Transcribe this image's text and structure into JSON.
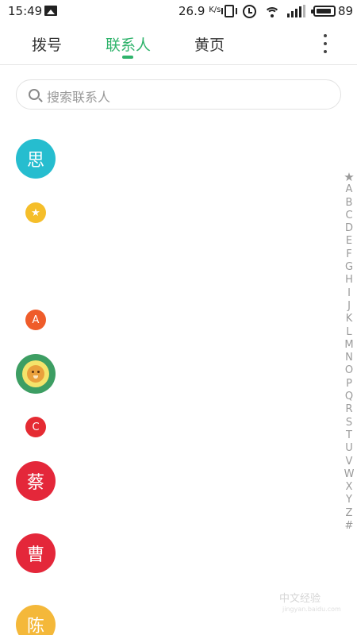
{
  "status_bar": {
    "time": "15:49",
    "network_speed": "26.9",
    "network_speed_unit": "K/s",
    "battery_level": "89",
    "icons": [
      "image-notification-icon",
      "vibrate-icon",
      "alarm-icon",
      "wifi-icon",
      "signal-icon",
      "battery-icon"
    ]
  },
  "tabs": [
    {
      "label": "拨号",
      "active": false
    },
    {
      "label": "联系人",
      "active": true
    },
    {
      "label": "黄页",
      "active": false
    }
  ],
  "accent_color": "#2fb36b",
  "search": {
    "placeholder": "搜索联系人"
  },
  "contacts": {
    "si_initial": "思",
    "star_symbol": "★",
    "section_a": "A",
    "section_c": "C",
    "cai_initial": "蔡",
    "cao_initial": "曹",
    "chen_initial": "陈"
  },
  "index": [
    "★",
    "A",
    "B",
    "C",
    "D",
    "E",
    "F",
    "G",
    "H",
    "I",
    "J",
    "K",
    "L",
    "M",
    "N",
    "O",
    "P",
    "Q",
    "R",
    "S",
    "T",
    "U",
    "V",
    "W",
    "X",
    "Y",
    "Z",
    "#"
  ],
  "watermark": {
    "text": "中文经验",
    "sub": "jingyan.baidu.com"
  }
}
